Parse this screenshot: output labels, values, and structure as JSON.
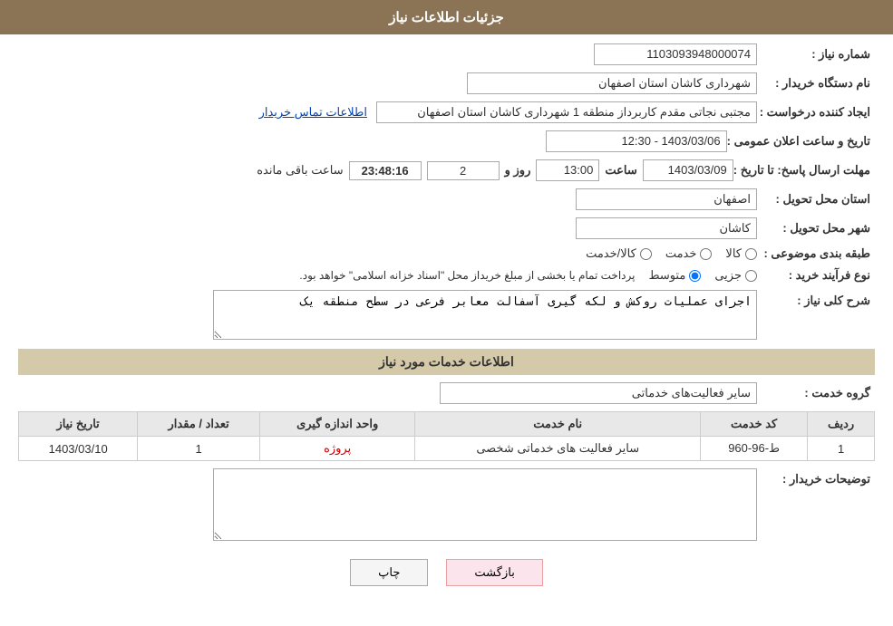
{
  "header": {
    "title": "جزئیات اطلاعات نیاز"
  },
  "fields": {
    "need_number_label": "شماره نیاز :",
    "need_number_value": "1103093948000074",
    "buyer_org_label": "نام دستگاه خریدار :",
    "buyer_org_value": "شهرداری کاشان استان اصفهان",
    "creator_label": "ایجاد کننده درخواست :",
    "creator_value": "مجتبی نجاتی مقدم کاربرداز منطقه 1 شهرداری کاشان استان اصفهان",
    "contact_link": "اطلاعات تماس خریدار",
    "announce_datetime_label": "تاریخ و ساعت اعلان عمومی :",
    "announce_datetime_value": "1403/03/06 - 12:30",
    "deadline_label": "مهلت ارسال پاسخ: تا تاریخ :",
    "deadline_date": "1403/03/09",
    "deadline_time_label": "ساعت",
    "deadline_time_value": "13:00",
    "deadline_days_label": "روز و",
    "deadline_days_value": "2",
    "remaining_label": "ساعت باقی مانده",
    "remaining_time": "23:48:16",
    "province_label": "استان محل تحویل :",
    "province_value": "اصفهان",
    "city_label": "شهر محل تحویل :",
    "city_value": "کاشان",
    "category_label": "طبقه بندی موضوعی :",
    "category_options": [
      "کالا",
      "خدمت",
      "کالا/خدمت"
    ],
    "category_selected": "کالا",
    "process_label": "نوع فرآیند خرید :",
    "process_options": [
      "جزیی",
      "متوسط"
    ],
    "process_selected": "متوسط",
    "process_note": "پرداخت تمام یا بخشی از مبلغ خریداز محل \"اسناد خزانه اسلامی\" خواهد بود.",
    "need_description_label": "شرح کلی نیاز :",
    "need_description_value": "اجرای عملیات روکش و لکه گیری آسفالت معابر فرعی در سطح منطقه یک",
    "services_section_title": "اطلاعات خدمات مورد نیاز",
    "service_group_label": "گروه خدمت :",
    "service_group_value": "سایر فعالیت‌های خدماتی",
    "table": {
      "headers": [
        "ردیف",
        "کد خدمت",
        "نام خدمت",
        "واحد اندازه گیری",
        "تعداد / مقدار",
        "تاریخ نیاز"
      ],
      "rows": [
        {
          "row_num": "1",
          "service_code": "ط-96-960",
          "service_name": "سایر فعالیت های خدماتی شخصی",
          "unit": "پروژه",
          "quantity": "1",
          "need_date": "1403/03/10"
        }
      ]
    },
    "buyer_description_label": "توضیحات خریدار :",
    "buyer_description_value": ""
  },
  "buttons": {
    "print_label": "چاپ",
    "back_label": "بازگشت"
  }
}
